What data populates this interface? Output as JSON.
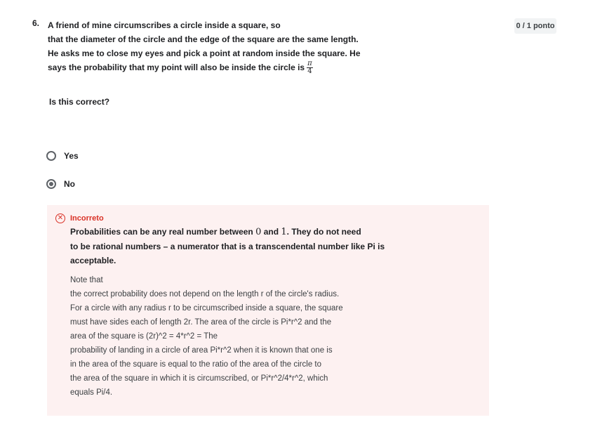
{
  "question": {
    "number": "6.",
    "lines": [
      "A friend of mine circumscribes a circle inside a square, so",
      "that the diameter of the circle and the edge of the square are the same length.",
      "He asks me to close my eyes and pick a point at random inside the square. He",
      "says the probability that my point will also be inside the circle is"
    ],
    "fraction": {
      "numerator": "π",
      "denominator": "4"
    },
    "points": "0 / 1 ponto",
    "subquestion": "Is this correct?"
  },
  "options": [
    {
      "label": "Yes",
      "selected": false
    },
    {
      "label": "No",
      "selected": true
    }
  ],
  "feedback": {
    "status": "Incorreto",
    "icon": "x-circle-icon",
    "status_color": "#d93025",
    "bold_parts": {
      "p1": "Probabilities can be any real number between ",
      "n0": "0",
      "p2": " and ",
      "n1": "1",
      "p3": ". They do not need"
    },
    "bold_lines": [
      "to be rational numbers – a numerator that is a transcendental number like Pi is",
      "acceptable."
    ],
    "note_lines": [
      "Note that",
      "the correct probability does not depend on the length r of the circle's radius.",
      "For a circle with any radius r to be circumscribed inside a square, the square",
      "must have sides each of length 2r. The area of the circle is Pi*r^2 and the",
      "area of the square is (2r)^2 = 4*r^2 =  The",
      "probability of landing in a circle of area Pi*r^2 when it is known that one is",
      "in the area of the square is equal to the ratio of the area of the circle to",
      "the area of the square in which it is circumscribed, or Pi*r^2/4*r^2, which",
      "equals Pi/4."
    ]
  }
}
